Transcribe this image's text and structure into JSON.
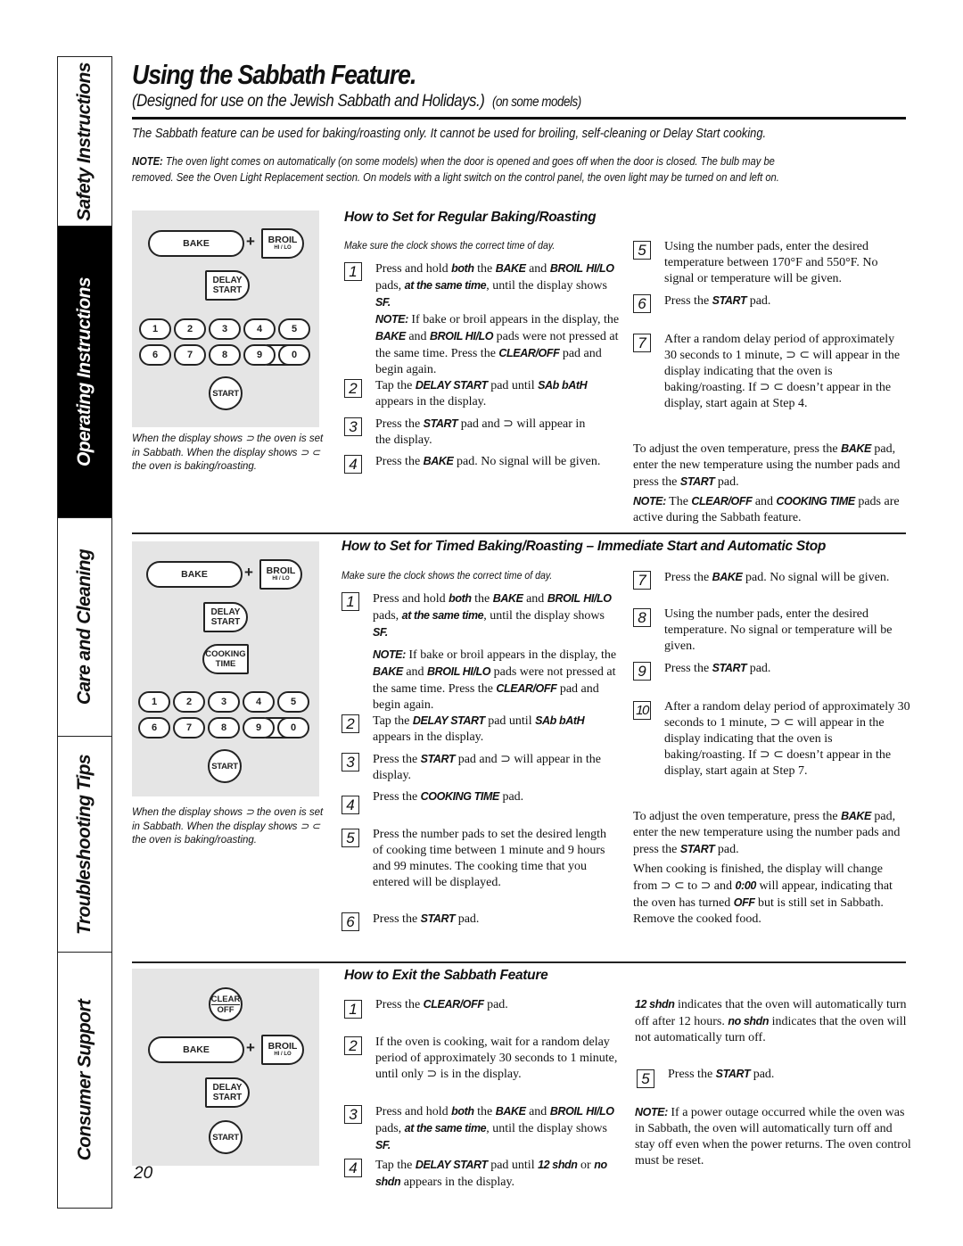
{
  "side_tabs": [
    {
      "label": "Safety Instructions",
      "active": false
    },
    {
      "label": "Operating Instructions",
      "active": true
    },
    {
      "label": "Care and Cleaning",
      "active": false
    },
    {
      "label": "Troubleshooting Tips",
      "active": false
    },
    {
      "label": "Consumer Support",
      "active": false
    }
  ],
  "header": {
    "title": "Using the Sabbath Feature.",
    "subtitle": "(Designed for use on the Jewish Sabbath and Holidays.)",
    "subtitle_note": "(on some models)"
  },
  "intro": {
    "line1": "The Sabbath feature can be used for baking/roasting only. It cannot be used for broiling, self-cleaning or Delay Start cooking.",
    "note_label": "NOTE:",
    "note_line1": "The oven light comes on automatically (on some models) when the door is opened and goes off when the door is closed. The bulb may be",
    "note_line2": "removed. See the Oven Light Replacement section. On models with a light switch on the control panel, the oven light may be turned on and left on."
  },
  "keypad": {
    "bake": "BAKE",
    "plus": "+",
    "broil": "BROIL",
    "broil_sub": "HI / LO",
    "delay_1": "DELAY",
    "delay_2": "START",
    "cooking_1": "COOKING",
    "cooking_2": "TIME",
    "start": "START",
    "clear": "CLEAR",
    "off": "OFF",
    "numbers": [
      "1",
      "2",
      "3",
      "4",
      "5",
      "6",
      "7",
      "8",
      "9",
      "0"
    ]
  },
  "caption": "When the display shows ⊃ the oven is set in Sabbath. When the display shows ⊃ ⊂ the oven is baking/roasting.",
  "regular": {
    "heading": "How to Set for Regular Baking/Roasting",
    "clock_note": "Make sure the clock shows the correct time of day.",
    "steps": [
      {
        "n": "1"
      },
      {
        "n": "2"
      },
      {
        "n": "3"
      },
      {
        "n": "4"
      },
      {
        "n": "5"
      },
      {
        "n": "6"
      },
      {
        "n": "7"
      }
    ]
  },
  "timed": {
    "heading": "How to Set for Timed Baking/Roasting – Immediate Start and Automatic Stop",
    "clock_note": "Make sure the clock shows the correct time of day.",
    "steps": [
      {
        "n": "1"
      },
      {
        "n": "2"
      },
      {
        "n": "3"
      },
      {
        "n": "4"
      },
      {
        "n": "5"
      },
      {
        "n": "6"
      },
      {
        "n": "7"
      },
      {
        "n": "8"
      },
      {
        "n": "9"
      },
      {
        "n": "10"
      }
    ]
  },
  "exit": {
    "heading": "How to Exit the Sabbath Feature",
    "steps": [
      {
        "n": "1"
      },
      {
        "n": "2"
      },
      {
        "n": "3"
      },
      {
        "n": "4"
      },
      {
        "n": "5"
      }
    ]
  },
  "text": {
    "press_hold": "Press and hold ",
    "both": "both",
    "the": " the ",
    "bake_k": "BAKE",
    "and": " and ",
    "broil_k": "BROIL",
    "hilo_k": "HI/LO",
    "pads_comma": " pads, ",
    "same_time": "at the same time",
    "until_the": ", until the",
    "display_shows": "display shows ",
    "sf": "SF.",
    "note_k": "NOTE:",
    "if_bake": " If bake or broil appears in the display, the ",
    "bake_and": " and ",
    "broil_hilo_k": "BROIL HI/LO",
    "were_not": " pads were not pressed at the same time. Press the ",
    "clear_off_k": "CLEAR/OFF",
    "pad_begin": " pad and begin again.",
    "tap_the": "Tap the ",
    "delay_start_k": "DELAY START",
    "pad_until": " pad until ",
    "sabbath_k": "SAb bAtH",
    "appears": " appears in the display.",
    "press_the": "Press the ",
    "start_k": "START",
    "start_pad_appear": " pad and ⊃ will appear in the display.",
    "pad": " pad.",
    "bake_pad_nosignal": " pad. No signal will be given.",
    "using_number_temp": "Using the number pads, enter the desired temperature between 170°F and 550°F. No signal or temperature will be given.",
    "after_random": "After a random delay period of approximately 30 seconds to 1 minute, ⊃ ⊂ will appear in the display indicating that the oven is baking/roasting. If ⊃ ⊂ doesn’t appear in the display, start again at Step 4.",
    "after_random_timed": "After a random delay period of approximately 30 seconds to 1 minute, ⊃ ⊂ will appear in the display indicating that the oven is baking/roasting. If ⊃ ⊂ doesn’t appear in the display, start again at Step 7.",
    "adjust_1": "To adjust the oven temperature, press the ",
    "adjust_2": " pad, enter the new temperature using the number pads and press the ",
    "note_active_1": " The ",
    "cooking_time_k": "COOKING TIME",
    "note_active_2": " pads are active during the Sabbath feature.",
    "cooking_time_pad": " pad.",
    "number_pads_time": "Press the number pads to set the desired length of cooking time between 1 minute and 9 hours and 99 minutes. The cooking time that you entered will be displayed.",
    "using_number_plain": "Using the number pads, enter the desired temperature. No signal or temperature will be given.",
    "finished_1": "When cooking is finished, the display will change from ⊃ ⊂ to ⊃ and ",
    "zero_k": "0:00",
    "finished_2": " will appear, indicating that the oven has turned ",
    "off_k": "OFF",
    "finished_3": " but is still set in Sabbath. Remove the cooked food.",
    "wait_random": "If the oven is cooking, wait for a random delay period of approximately 30 seconds to 1 minute, until only ⊃ is in the display.",
    "shdn12_k": "12 shdn",
    "or": " or ",
    "noshdn_k": "no shdn",
    "shdn12_desc": " indicates that the oven will automatically turn off after 12 hours. ",
    "noshdn_desc": " indicates that the oven will not automatically turn off.",
    "power_note": " If a power outage occurred while the oven was in Sabbath, the oven will automatically turn off and stay off even when the power returns. The oven control must be reset."
  },
  "page_number": "20"
}
